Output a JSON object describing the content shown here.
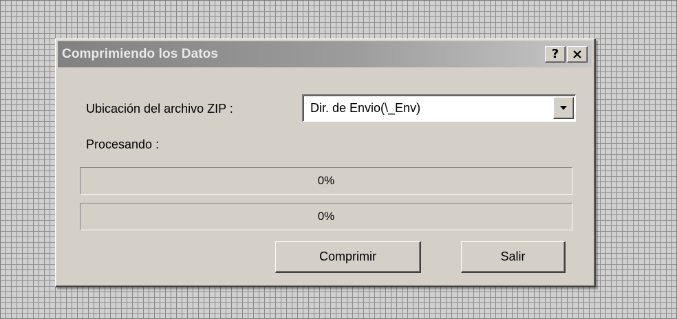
{
  "dialog": {
    "title": "Comprimiendo los Datos",
    "help_button": "?",
    "close_button": "✕"
  },
  "form": {
    "zip_location_label": "Ubicación del archivo ZIP :",
    "zip_location_value": "Dir. de Envio(\\_Env)",
    "processing_label": "Procesando :"
  },
  "progress": [
    {
      "text": "0%",
      "value": 0
    },
    {
      "text": "0%",
      "value": 0
    }
  ],
  "buttons": {
    "compress": "Comprimir",
    "exit": "Salir"
  }
}
